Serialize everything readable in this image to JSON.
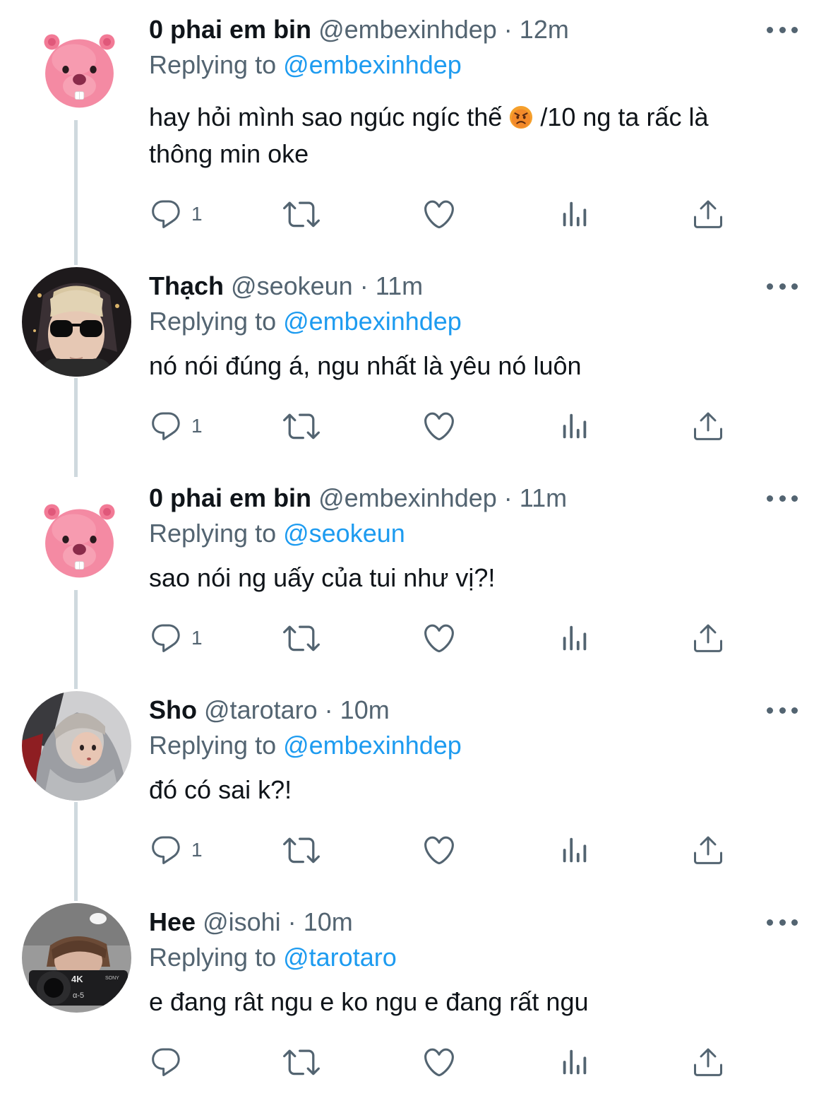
{
  "tweets": [
    {
      "display_name": "0 phai em bin",
      "handle": "@embexinhdep",
      "separator": "·",
      "time": "12m",
      "replying_prefix": "Replying to ",
      "replying_handle": "@embexinhdep",
      "text_before": "hay hỏi mình sao ngúc ngíc thế ",
      "emoji": "angry-face-emoji",
      "text_after": " /10 ng ta rấc là thông min oke",
      "reply_count": "1",
      "avatar": "pink-beaver-avatar"
    },
    {
      "display_name": "Thạch",
      "handle": "@seokeun",
      "separator": "·",
      "time": "11m",
      "replying_prefix": "Replying to ",
      "replying_handle": "@embexinhdep",
      "text": "nó nói đúng á, ngu nhất là yêu nó luôn",
      "reply_count": "1",
      "avatar": "sunglasses-person-avatar"
    },
    {
      "display_name": "0 phai em bin",
      "handle": "@embexinhdep",
      "separator": "·",
      "time": "11m",
      "replying_prefix": "Replying to ",
      "replying_handle": "@seokeun",
      "text": "sao nói ng uấy của tui như vị?!",
      "reply_count": "1",
      "avatar": "pink-beaver-avatar"
    },
    {
      "display_name": "Sho",
      "handle": "@tarotaro",
      "separator": "·",
      "time": "10m",
      "replying_prefix": "Replying to ",
      "replying_handle": "@embexinhdep",
      "text": "đó có sai k?!",
      "reply_count": "1",
      "avatar": "hooded-person-avatar"
    },
    {
      "display_name": "Hee",
      "handle": "@isohi",
      "separator": "·",
      "time": "10m",
      "replying_prefix": "Replying to ",
      "replying_handle": "@tarotaro",
      "text": "e đang rât ngu e ko ngu e đang rất ngu",
      "reply_count": "",
      "avatar": "camera-person-avatar"
    }
  ],
  "colors": {
    "text": "#0f1419",
    "secondary": "#536471",
    "link": "#1d9bf0",
    "thread_line": "#cfd9de"
  },
  "icons": [
    "reply-icon",
    "retweet-icon",
    "like-icon",
    "analytics-icon",
    "share-icon",
    "more-icon"
  ]
}
